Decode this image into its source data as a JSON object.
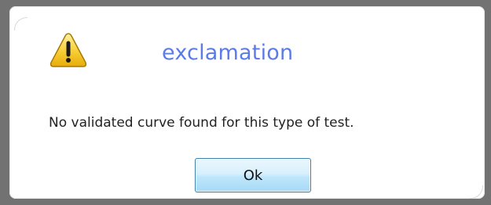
{
  "dialog": {
    "title": "exclamation",
    "message": "No validated curve found for this type of test.",
    "ok_label": "Ok",
    "icon": "warning-triangle-icon",
    "title_color": "#5b7be8",
    "button_border_color": "#3c7fb1",
    "icon_color": "#f2c012"
  }
}
